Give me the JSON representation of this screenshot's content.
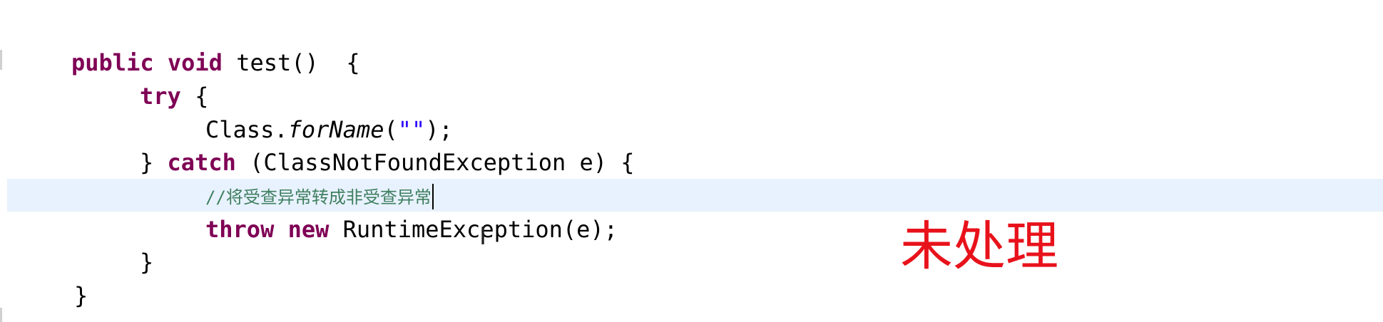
{
  "code": {
    "line1": {
      "kw1": "public",
      "kw2": "void",
      "rest": "test()  {"
    },
    "line2": {
      "kw": "try",
      "rest": " {"
    },
    "line3": {
      "pre": "Class.",
      "method": "forName",
      "open": "(",
      "str": "\"\"",
      "close": ");"
    },
    "line4": {
      "pre": "} ",
      "kw": "catch",
      "rest": " (ClassNotFoundException e) {"
    },
    "line5": {
      "comment": "//将受查异常转成非受查异常"
    },
    "line6": {
      "kw1": "throw",
      "kw2": "new",
      "rest": "RuntimeException(e);"
    },
    "line7": {
      "text": "}"
    },
    "line8": {
      "text": "}"
    }
  },
  "annotation": {
    "text": "未处理",
    "color": "#e8121b"
  },
  "cursor": {
    "ibeam": "I"
  },
  "colors": {
    "keyword": "#7f0055",
    "string": "#2a00ff",
    "comment": "#3f7f5f",
    "current_line": "#e8f2fe"
  }
}
